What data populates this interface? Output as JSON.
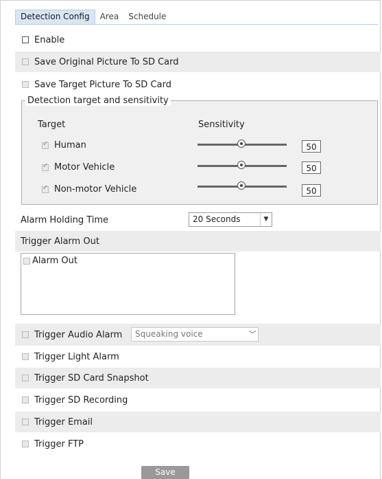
{
  "tabs": [
    "Detection Config",
    "Area",
    "Schedule"
  ],
  "options": {
    "enable": "Enable",
    "save_original": "Save Original Picture To SD Card",
    "save_target": "Save Target Picture To SD Card"
  },
  "detection": {
    "legend": "Detection target and sensitivity",
    "target_header": "Target",
    "sensitivity_header": "Sensitivity",
    "targets": [
      {
        "label": "Human",
        "checked": true,
        "sensitivity": "50"
      },
      {
        "label": "Motor Vehicle",
        "checked": true,
        "sensitivity": "50"
      },
      {
        "label": "Non-motor Vehicle",
        "checked": true,
        "sensitivity": "50"
      }
    ]
  },
  "alarm_holding": {
    "label": "Alarm Holding Time",
    "value": "20 Seconds"
  },
  "trigger_alarm_out": {
    "label": "Trigger Alarm Out",
    "item": "Alarm Out"
  },
  "audio": {
    "label": "Trigger Audio Alarm",
    "value": "Squeaking voice"
  },
  "triggers": {
    "light": "Trigger Light Alarm",
    "sd_snapshot": "Trigger SD Card Snapshot",
    "sd_recording": "Trigger SD Recording",
    "email": "Trigger Email",
    "ftp": "Trigger FTP"
  },
  "save_label": "Save",
  "colors": {
    "tab_active": "#d9e5f3",
    "row_shade": "#ececec",
    "save_button": "#999999"
  }
}
